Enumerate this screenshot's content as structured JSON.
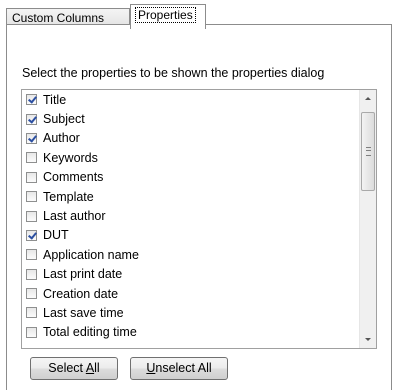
{
  "tabs": [
    {
      "label": "Custom Columns"
    },
    {
      "label": "Properties"
    }
  ],
  "instruction": "Select the properties to be shown the properties dialog",
  "properties": [
    {
      "label": "Title",
      "checked": true
    },
    {
      "label": "Subject",
      "checked": true
    },
    {
      "label": "Author",
      "checked": true
    },
    {
      "label": "Keywords",
      "checked": false
    },
    {
      "label": "Comments",
      "checked": false
    },
    {
      "label": "Template",
      "checked": false
    },
    {
      "label": "Last author",
      "checked": false
    },
    {
      "label": "DUT",
      "checked": true
    },
    {
      "label": "Application name",
      "checked": false
    },
    {
      "label": "Last print date",
      "checked": false
    },
    {
      "label": "Creation date",
      "checked": false
    },
    {
      "label": "Last save time",
      "checked": false
    },
    {
      "label": "Total editing time",
      "checked": false
    }
  ],
  "buttons": {
    "select_all": {
      "prefix": "Select ",
      "mnemonic": "A",
      "suffix": "ll"
    },
    "unselect_all": {
      "prefix": "",
      "mnemonic": "U",
      "suffix": "nselect All"
    }
  },
  "icons": {
    "check": "check-icon",
    "scroll_up": "chevron-up-icon",
    "scroll_down": "chevron-down-icon"
  }
}
